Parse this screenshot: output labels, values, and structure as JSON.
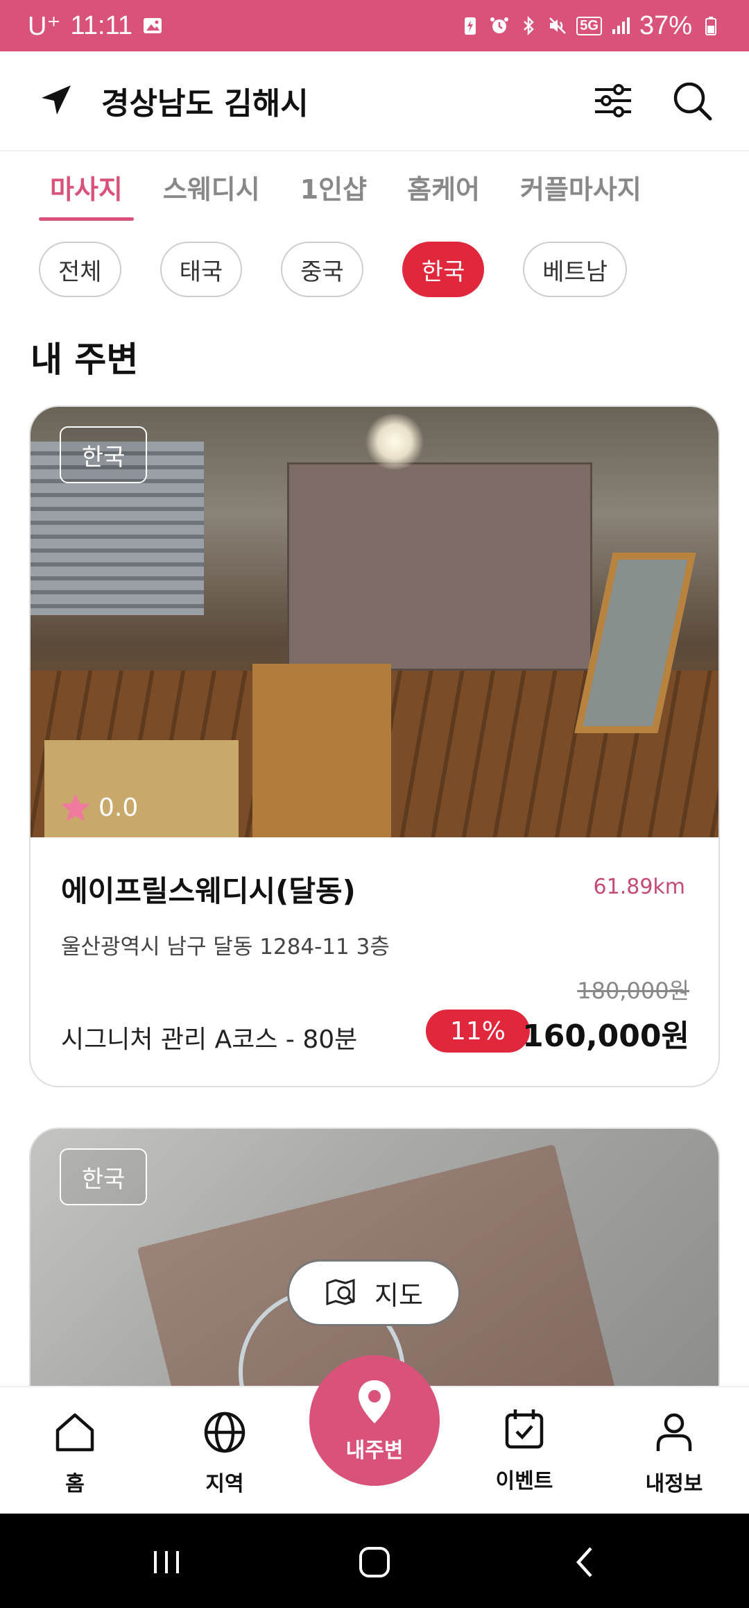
{
  "status_bar": {
    "carrier": "U⁺",
    "time": "11:11",
    "network": "5G",
    "battery": "37%"
  },
  "header": {
    "location_title": "경상남도 김해시"
  },
  "tabs": [
    {
      "label": "마사지",
      "active": true
    },
    {
      "label": "스웨디시",
      "active": false
    },
    {
      "label": "1인샵",
      "active": false
    },
    {
      "label": "홈케어",
      "active": false
    },
    {
      "label": "커플마사지",
      "active": false
    }
  ],
  "chips": [
    {
      "label": "전체",
      "active": false
    },
    {
      "label": "태국",
      "active": false
    },
    {
      "label": "중국",
      "active": false
    },
    {
      "label": "한국",
      "active": true
    },
    {
      "label": "베트남",
      "active": false
    }
  ],
  "section_title": "내 주변",
  "cards": [
    {
      "country": "한국",
      "rating": "0.0",
      "name": "에이프릴스웨디시(달동)",
      "distance": "61.89km",
      "address": "울산광역시 남구 달동 1284-11 3층",
      "original_price": "180,000원",
      "course": "시그니처 관리 A코스 - 80분",
      "discount": "11%",
      "price": "160,000원"
    },
    {
      "country": "한국"
    }
  ],
  "map_button": {
    "label": "지도"
  },
  "bottom_nav": {
    "home": "홈",
    "region": "지역",
    "nearby": "내주변",
    "event": "이벤트",
    "profile": "내정보"
  },
  "colors": {
    "brand": "#d9527a",
    "accent_red": "#e0273c"
  }
}
